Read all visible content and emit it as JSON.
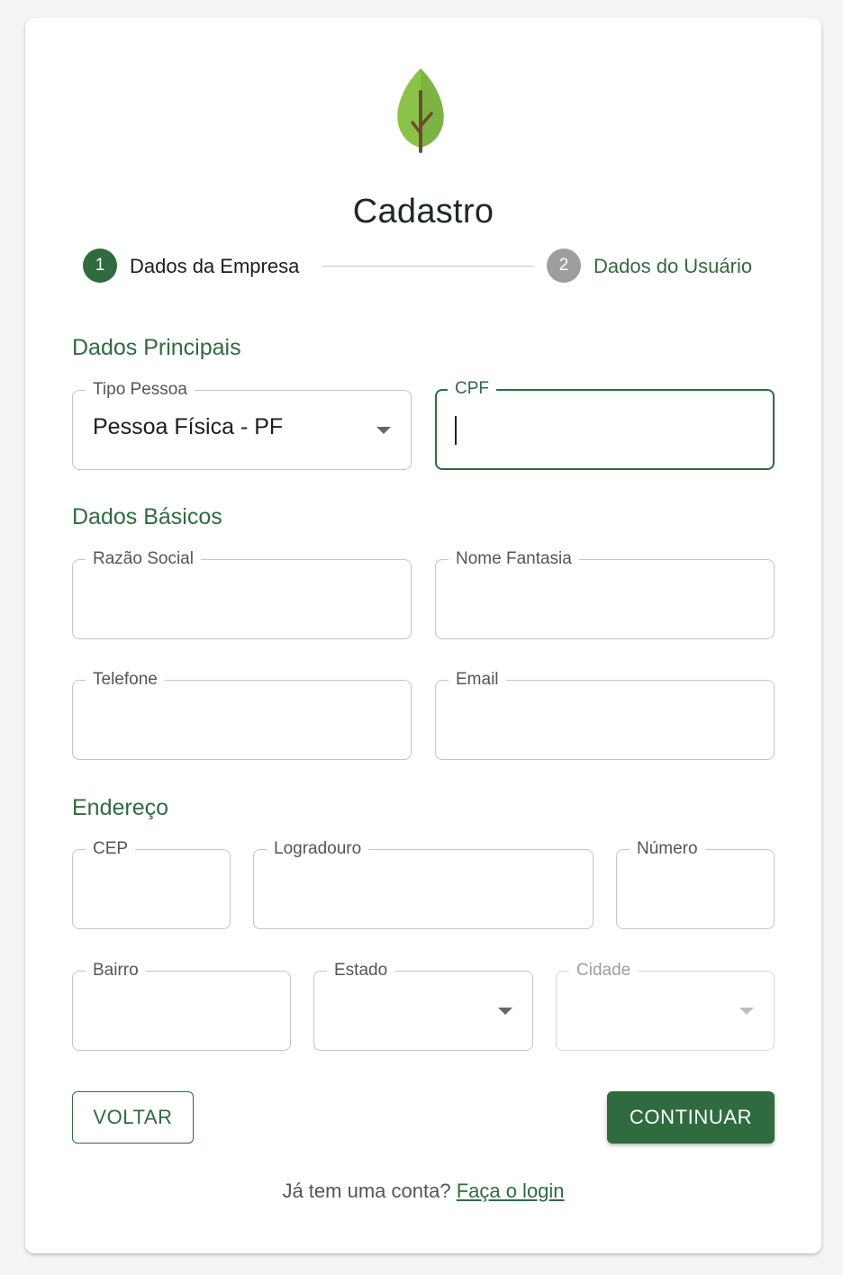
{
  "header": {
    "logo_icon": "leaf-icon",
    "title": "Cadastro"
  },
  "stepper": {
    "steps": [
      {
        "number": "1",
        "label": "Dados da Empresa",
        "active": true
      },
      {
        "number": "2",
        "label": "Dados do Usuário",
        "active": false
      }
    ]
  },
  "sections": {
    "principais": "Dados Principais",
    "basicos": "Dados Básicos",
    "endereco": "Endereço"
  },
  "fields": {
    "tipo_pessoa": {
      "label": "Tipo Pessoa",
      "value": "Pessoa Física - PF"
    },
    "cpf": {
      "label": "CPF",
      "value": ""
    },
    "razao_social": {
      "label": "Razão Social",
      "value": ""
    },
    "nome_fantasia": {
      "label": "Nome Fantasia",
      "value": ""
    },
    "telefone": {
      "label": "Telefone",
      "value": ""
    },
    "email": {
      "label": "Email",
      "value": ""
    },
    "cep": {
      "label": "CEP",
      "value": ""
    },
    "logradouro": {
      "label": "Logradouro",
      "value": ""
    },
    "numero": {
      "label": "Número",
      "value": ""
    },
    "bairro": {
      "label": "Bairro",
      "value": ""
    },
    "estado": {
      "label": "Estado",
      "value": ""
    },
    "cidade": {
      "label": "Cidade",
      "value": ""
    }
  },
  "buttons": {
    "back": "VOLTAR",
    "continue": "CONTINUAR"
  },
  "footer": {
    "text": "Já tem uma conta?",
    "link": "Faça o login"
  },
  "colors": {
    "primary": "#2f6b3e",
    "inactive_step": "#9e9e9e"
  }
}
